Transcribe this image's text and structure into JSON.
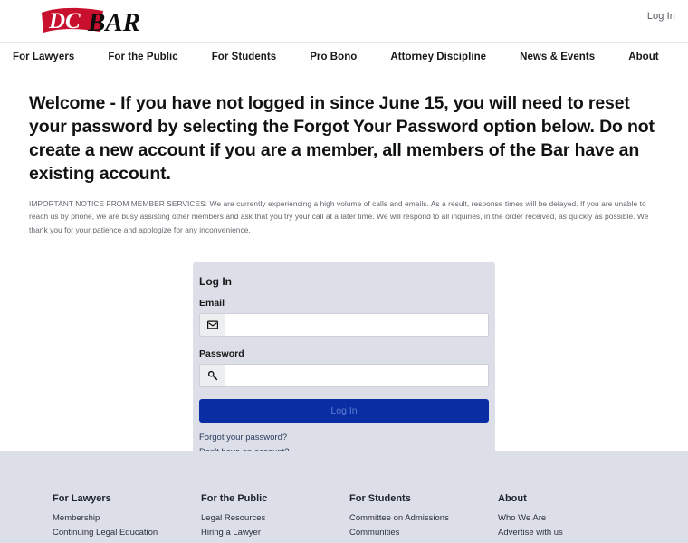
{
  "header": {
    "logo": {
      "name": "dc-bar-logo",
      "dc_text": "DC",
      "bar_text": "BAR",
      "red": "#C8102E"
    },
    "top_login_label": "Log In"
  },
  "nav": {
    "items": [
      {
        "label": "For Lawyers"
      },
      {
        "label": "For the Public"
      },
      {
        "label": "For Students"
      },
      {
        "label": "Pro Bono"
      },
      {
        "label": "Attorney Discipline"
      },
      {
        "label": "News & Events"
      },
      {
        "label": "About"
      }
    ]
  },
  "main": {
    "welcome_heading": "Welcome - If you have not logged in since June 15, you will need to reset your password by selecting the Forgot Your Password option below. Do not create a new account if you are a member, all members of the Bar have an existing account.",
    "notice": "IMPORTANT NOTICE FROM MEMBER SERVICES: We are currently experiencing a high volume of calls and emails. As a result, response times will be delayed. If you are unable to reach us by phone, we are busy assisting other members and ask that you try your call at a later time. We will respond to all inquiries, in the order received, as quickly as possible. We thank you for your patience and apologize for any inconvenience."
  },
  "login_card": {
    "title": "Log In",
    "email_label": "Email",
    "email_value": "",
    "email_placeholder": "",
    "email_icon": "envelope-icon",
    "password_label": "Password",
    "password_value": "",
    "password_placeholder": "",
    "password_icon": "key-icon",
    "submit_label": "Log In",
    "submit_color": "#0a2da3",
    "forgot_password_label": "Forgot your password?",
    "no_account_label": "Don't have an account?",
    "background": "#dcdfe7"
  },
  "footer": {
    "background": "#dcdfe7",
    "columns": [
      {
        "heading": "For Lawyers",
        "links": [
          {
            "label": "Membership"
          },
          {
            "label": "Continuing Legal Education"
          }
        ]
      },
      {
        "heading": "For the Public",
        "links": [
          {
            "label": "Legal Resources"
          },
          {
            "label": "Hiring a Lawyer"
          }
        ]
      },
      {
        "heading": "For Students",
        "links": [
          {
            "label": "Committee on Admissions"
          },
          {
            "label": "Communities"
          }
        ]
      },
      {
        "heading": "About",
        "links": [
          {
            "label": "Who We Are"
          },
          {
            "label": "Advertise with us"
          }
        ]
      }
    ]
  }
}
